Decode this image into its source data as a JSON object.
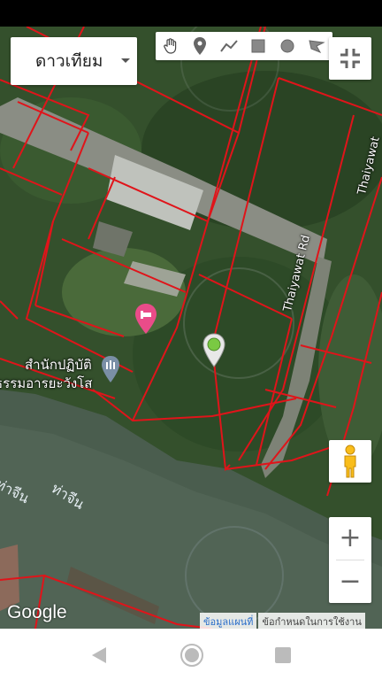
{
  "map_type": {
    "label": "ดาวเทียม"
  },
  "toolbar": {
    "tools": [
      {
        "icon": "hand-pan-icon"
      },
      {
        "icon": "marker-icon"
      },
      {
        "icon": "polyline-icon"
      },
      {
        "icon": "rectangle-icon"
      },
      {
        "icon": "circle-icon"
      },
      {
        "icon": "polygon-icon"
      }
    ]
  },
  "poi": {
    "temple_line1": "สำนักปฏิบัติ",
    "temple_line2": "ธรรมอารยะวังโส"
  },
  "roads": {
    "thaiyawat_rd": "Thaiyawat Rd",
    "thaiyawat_top": "Thaiyawat"
  },
  "river": {
    "label1": "ท่าจีน",
    "label2": "ท่าจีน"
  },
  "zoom": {
    "plus": "+",
    "minus": "−"
  },
  "logo": {
    "text": "Google"
  },
  "attribution": {
    "map_data": "ข้อมูลแผนที่",
    "terms": "ข้อกำหนดในการใช้งาน"
  },
  "colors": {
    "parcel_lines": "#e0141a",
    "marker_green": "#7ac943",
    "hotel_pin": "#ea4c89"
  }
}
